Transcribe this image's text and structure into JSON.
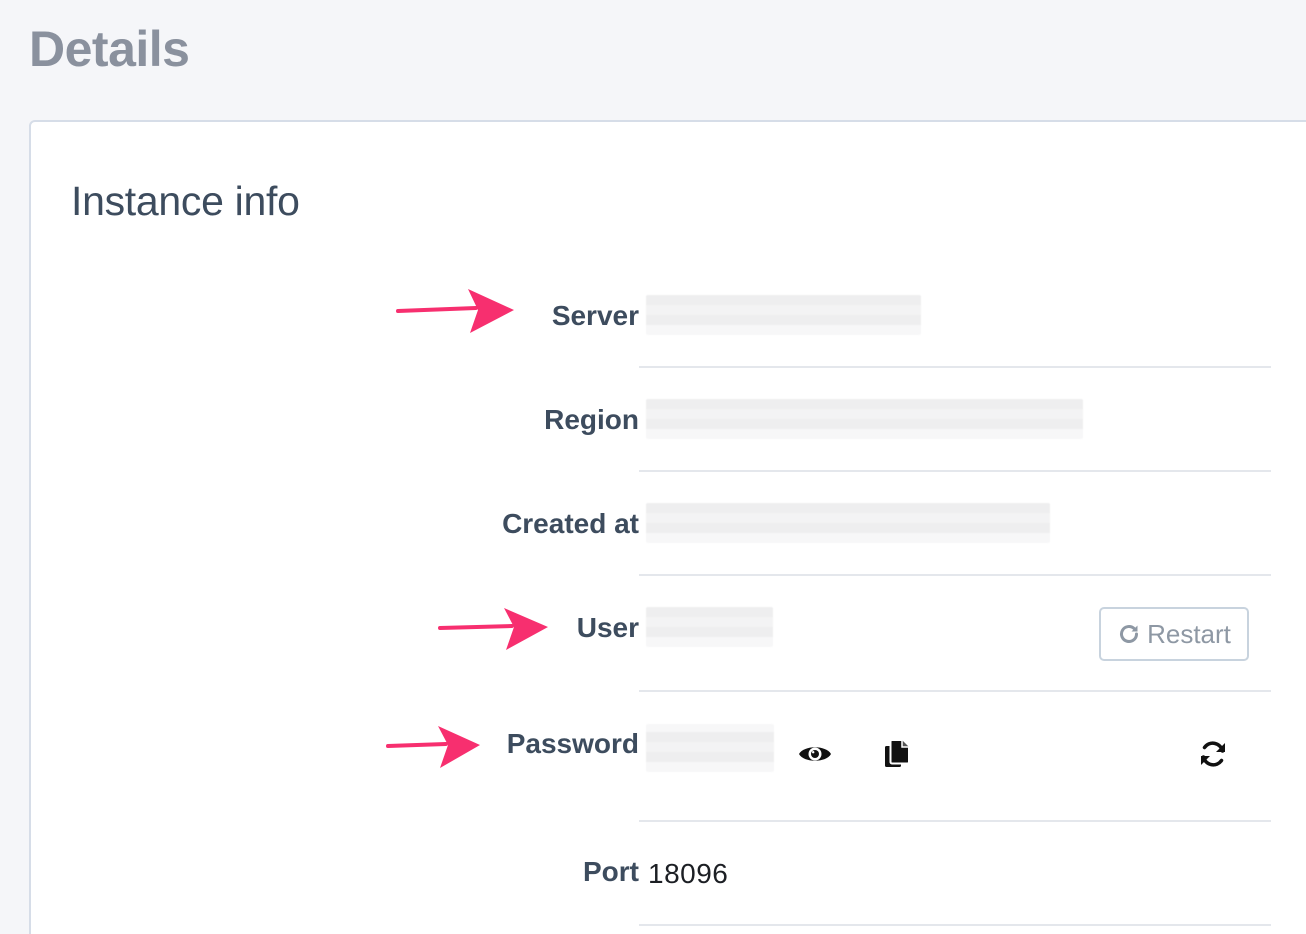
{
  "page": {
    "title": "Details"
  },
  "card": {
    "title": "Instance info"
  },
  "fields": {
    "server": {
      "label": "Server"
    },
    "region": {
      "label": "Region"
    },
    "created_at": {
      "label": "Created at"
    },
    "user": {
      "label": "User"
    },
    "password": {
      "label": "Password"
    },
    "port": {
      "label": "Port",
      "value": "18096"
    }
  },
  "actions": {
    "restart_label": "Restart"
  },
  "icons": {
    "restart": "rotate-right-icon",
    "show_password": "eye-icon",
    "copy_password": "copy-icon",
    "regenerate_password": "sync-icon"
  },
  "annotation_color": "#f72f6f"
}
